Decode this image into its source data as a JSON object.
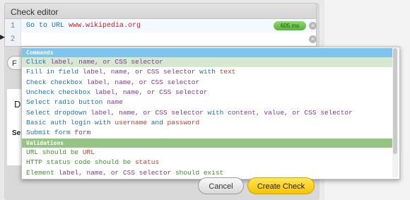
{
  "panel": {
    "title": "Check editor"
  },
  "editor": {
    "lines": [
      {
        "number": "1",
        "command": "Go to URL",
        "argument": "www.wikipedia.org",
        "time": "605 ms",
        "clear_icon": "close-icon"
      },
      {
        "number": "2",
        "command": "",
        "argument": "",
        "clear_icon": "close-icon"
      }
    ],
    "pointer_icon": "triangle-right-icon"
  },
  "background": {
    "partial_button_label": "F",
    "card_heading": "Da",
    "card_subheading": "Se"
  },
  "autocomplete": {
    "sections": [
      {
        "title": "Commands",
        "color": "#7ec4ef",
        "items": [
          {
            "parts": [
              {
                "text": "Click ",
                "c": "blue"
              },
              {
                "text": "label, name, or CSS selector",
                "c": "purple"
              }
            ]
          },
          {
            "parts": [
              {
                "text": "Fill in field ",
                "c": "blue"
              },
              {
                "text": "label, name, or CSS selector",
                "c": "purple"
              },
              {
                "text": " with ",
                "c": "blue"
              },
              {
                "text": "text",
                "c": "red"
              }
            ]
          },
          {
            "parts": [
              {
                "text": "Check checkbox ",
                "c": "blue"
              },
              {
                "text": "label, name, or CSS selector",
                "c": "purple"
              }
            ]
          },
          {
            "parts": [
              {
                "text": "Uncheck checkbox ",
                "c": "blue"
              },
              {
                "text": "label, name, or CSS selector",
                "c": "purple"
              }
            ]
          },
          {
            "parts": [
              {
                "text": "Select radio button ",
                "c": "blue"
              },
              {
                "text": "name",
                "c": "purple"
              }
            ]
          },
          {
            "parts": [
              {
                "text": "Select dropdown ",
                "c": "blue"
              },
              {
                "text": "label, name, or CSS selector",
                "c": "purple"
              },
              {
                "text": " with ",
                "c": "blue"
              },
              {
                "text": "content, value, or CSS selector",
                "c": "purple"
              }
            ]
          },
          {
            "parts": [
              {
                "text": "Basic auth login with ",
                "c": "blue"
              },
              {
                "text": "username",
                "c": "red"
              },
              {
                "text": " and ",
                "c": "blue"
              },
              {
                "text": "password",
                "c": "red"
              }
            ]
          },
          {
            "parts": [
              {
                "text": "Submit form ",
                "c": "blue"
              },
              {
                "text": "form",
                "c": "purple"
              }
            ]
          }
        ]
      },
      {
        "title": "Validations",
        "color": "#95c583",
        "items": [
          {
            "parts": [
              {
                "text": "URL should be ",
                "c": "green"
              },
              {
                "text": "URL",
                "c": "vred"
              }
            ]
          },
          {
            "parts": [
              {
                "text": "HTTP status code should be ",
                "c": "green"
              },
              {
                "text": "status",
                "c": "vred"
              }
            ]
          },
          {
            "parts": [
              {
                "text": "Element ",
                "c": "green"
              },
              {
                "text": "label, name, or CSS selector",
                "c": "purple"
              },
              {
                "text": " should exist",
                "c": "green"
              }
            ]
          }
        ]
      }
    ],
    "selected_section": 0,
    "selected_item": 0
  },
  "footer": {
    "cancel_label": "Cancel",
    "create_label": "Create Check"
  }
}
